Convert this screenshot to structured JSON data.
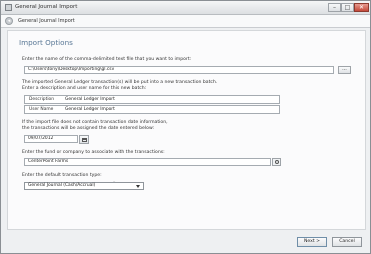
{
  "window": {
    "title": "General Journal Import",
    "min_glyph": "–",
    "max_glyph": "□",
    "close_glyph": "✕"
  },
  "header": {
    "back_glyph": "◂",
    "wizard_title": "General Journal Import"
  },
  "section": {
    "title": "Import Options"
  },
  "file": {
    "prompt": "Enter the name of the comma-delimited text file that you want to import:",
    "path": "C:\\Users\\tony\\Desktop\\Importing\\gl.csv",
    "browse_label": "..."
  },
  "batch": {
    "info_line1": "The imported General Ledger transaction(s) will be put into a new transaction batch.",
    "info_line2": "Enter a description and user name for this new batch:",
    "description_key": "Description",
    "description_value": "General Ledger Import",
    "username_key": "User Name",
    "username_value": "General Ledger Import"
  },
  "date": {
    "info_line1": "If the import file does not contain transaction date information,",
    "info_line2": "the transactions will be assigned the date entered below:",
    "value": "09/07/2012"
  },
  "fund": {
    "prompt": "Enter the fund or company to associate with the transactions:",
    "value": "CenterPoint Farms"
  },
  "transaction_type": {
    "prompt": "Enter the default transaction type:",
    "selected": "General Journal (Cash/Accrual)"
  },
  "footer": {
    "next_label": "Next >",
    "cancel_label": "Cancel"
  }
}
